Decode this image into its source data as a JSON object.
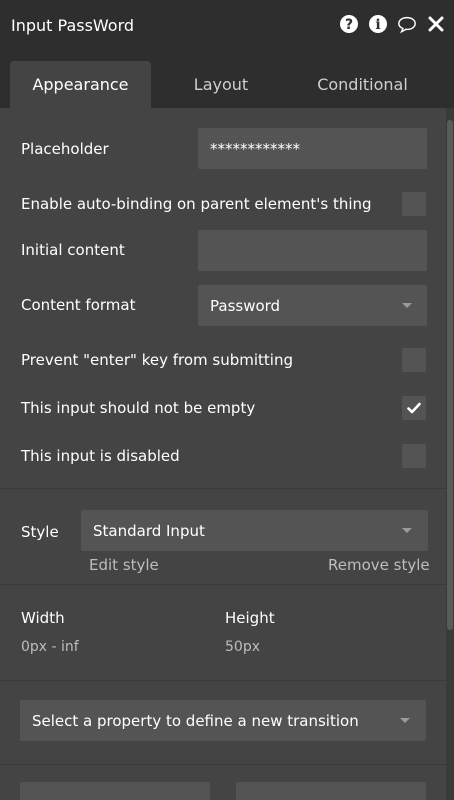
{
  "title_bar": {
    "title": "Input PassWord",
    "icons": [
      "help-icon",
      "info-icon",
      "comment-icon",
      "close-icon"
    ]
  },
  "tabs": [
    {
      "label": "Appearance",
      "active": true
    },
    {
      "label": "Layout",
      "active": false
    },
    {
      "label": "Conditional",
      "active": false
    }
  ],
  "fields": {
    "placeholder": {
      "label": "Placeholder",
      "value": "************"
    },
    "auto_binding": {
      "label": "Enable auto-binding on parent element's thing",
      "checked": false
    },
    "initial_content": {
      "label": "Initial content",
      "value": ""
    },
    "content_format": {
      "label": "Content format",
      "value": "Password"
    },
    "prevent_enter": {
      "label": "Prevent \"enter\" key from submitting",
      "checked": false
    },
    "not_empty": {
      "label": "This input should not be empty",
      "checked": true
    },
    "disabled": {
      "label": "This input is disabled",
      "checked": false
    }
  },
  "style": {
    "label": "Style",
    "value": "Standard Input",
    "edit_link": "Edit style",
    "remove_link": "Remove style"
  },
  "dimensions": {
    "width_label": "Width",
    "width_value": "0px - inf",
    "height_label": "Height",
    "height_value": "50px"
  },
  "transition": {
    "placeholder": "Select a property to define a new transition"
  },
  "colors": {
    "panel_bg": "#444444",
    "header_bg": "#2e2e2e",
    "field_bg": "#545454",
    "muted_text": "#bdbdbd"
  }
}
